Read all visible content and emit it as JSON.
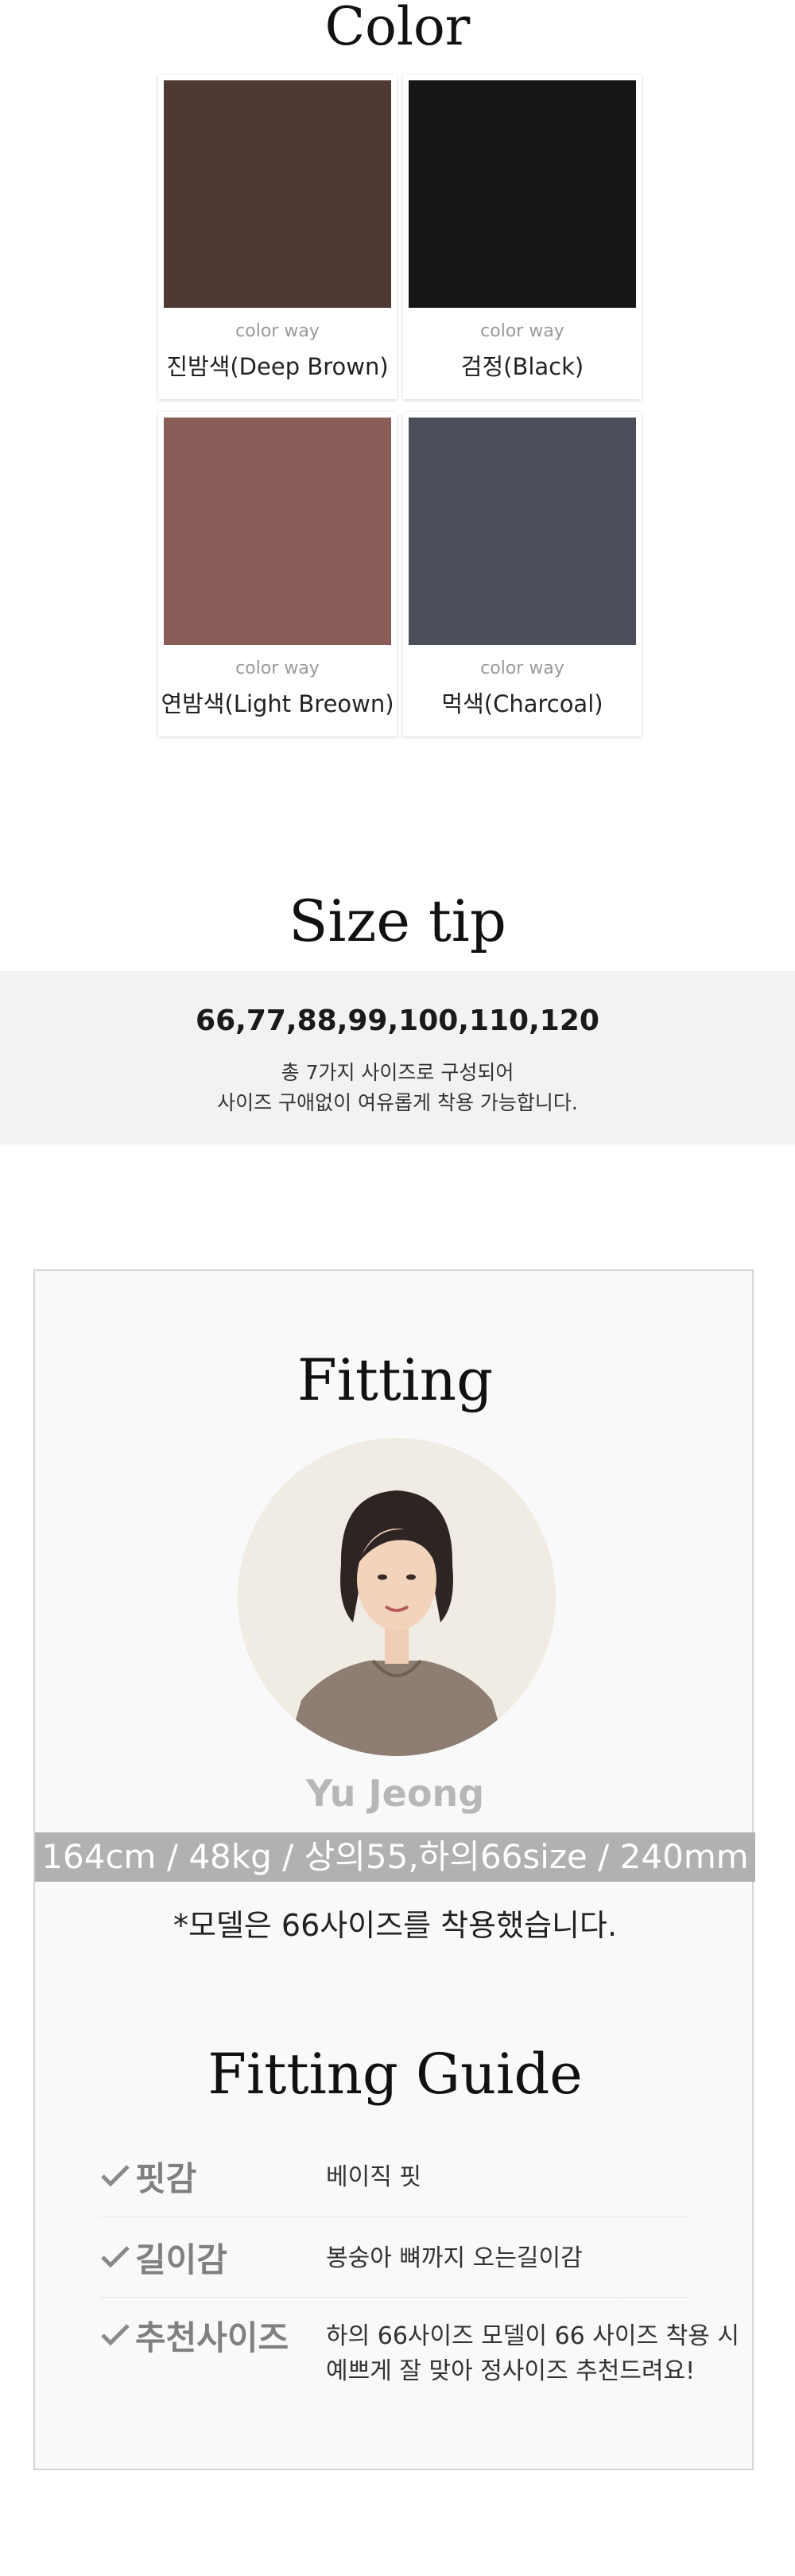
{
  "color_section": {
    "title": "Color",
    "swatches": [
      {
        "sub": "color way",
        "name": "진밤색(Deep Brown)",
        "color": "#4f3a33"
      },
      {
        "sub": "color way",
        "name": "검정(Black)",
        "color": "#161616"
      },
      {
        "sub": "color way",
        "name": "연밤색(Light Breown)",
        "color": "#8a5c58"
      },
      {
        "sub": "color way",
        "name": "먹색(Charcoal)",
        "color": "#4c4f5a"
      }
    ]
  },
  "size_tip": {
    "title": "Size tip",
    "sizes": "66,77,88,99,100,110,120",
    "desc_line1": "총 7가지 사이즈로 구성되어",
    "desc_line2": "사이즈 구애없이 여유롭게 착용 가능합니다."
  },
  "fitting": {
    "title": "Fitting",
    "model_name": "Yu Jeong",
    "stats": "164cm / 48kg / 상의55,하의66size / 240mm",
    "note": "*모델은 66사이즈를 착용했습니다."
  },
  "fitting_guide": {
    "title": "Fitting Guide",
    "rows": [
      {
        "label": "핏감",
        "value": "베이직 핏",
        "value2": ""
      },
      {
        "label": "길이감",
        "value": "봉숭아 뼈까지 오는길이감",
        "value2": ""
      },
      {
        "label": "추천사이즈",
        "value": "하의 66사이즈 모델이 66 사이즈 착용 시",
        "value2": "예쁘게 잘 맞아 정사이즈 추천드려요!"
      }
    ]
  }
}
